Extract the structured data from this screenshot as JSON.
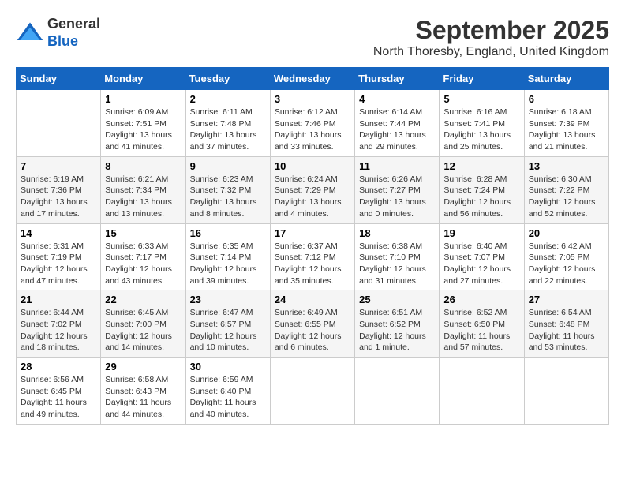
{
  "header": {
    "logo_line1": "General",
    "logo_line2": "Blue",
    "month": "September 2025",
    "location": "North Thoresby, England, United Kingdom"
  },
  "weekdays": [
    "Sunday",
    "Monday",
    "Tuesday",
    "Wednesday",
    "Thursday",
    "Friday",
    "Saturday"
  ],
  "weeks": [
    [
      {
        "day": "",
        "info": ""
      },
      {
        "day": "1",
        "info": "Sunrise: 6:09 AM\nSunset: 7:51 PM\nDaylight: 13 hours\nand 41 minutes."
      },
      {
        "day": "2",
        "info": "Sunrise: 6:11 AM\nSunset: 7:48 PM\nDaylight: 13 hours\nand 37 minutes."
      },
      {
        "day": "3",
        "info": "Sunrise: 6:12 AM\nSunset: 7:46 PM\nDaylight: 13 hours\nand 33 minutes."
      },
      {
        "day": "4",
        "info": "Sunrise: 6:14 AM\nSunset: 7:44 PM\nDaylight: 13 hours\nand 29 minutes."
      },
      {
        "day": "5",
        "info": "Sunrise: 6:16 AM\nSunset: 7:41 PM\nDaylight: 13 hours\nand 25 minutes."
      },
      {
        "day": "6",
        "info": "Sunrise: 6:18 AM\nSunset: 7:39 PM\nDaylight: 13 hours\nand 21 minutes."
      }
    ],
    [
      {
        "day": "7",
        "info": "Sunrise: 6:19 AM\nSunset: 7:36 PM\nDaylight: 13 hours\nand 17 minutes."
      },
      {
        "day": "8",
        "info": "Sunrise: 6:21 AM\nSunset: 7:34 PM\nDaylight: 13 hours\nand 13 minutes."
      },
      {
        "day": "9",
        "info": "Sunrise: 6:23 AM\nSunset: 7:32 PM\nDaylight: 13 hours\nand 8 minutes."
      },
      {
        "day": "10",
        "info": "Sunrise: 6:24 AM\nSunset: 7:29 PM\nDaylight: 13 hours\nand 4 minutes."
      },
      {
        "day": "11",
        "info": "Sunrise: 6:26 AM\nSunset: 7:27 PM\nDaylight: 13 hours\nand 0 minutes."
      },
      {
        "day": "12",
        "info": "Sunrise: 6:28 AM\nSunset: 7:24 PM\nDaylight: 12 hours\nand 56 minutes."
      },
      {
        "day": "13",
        "info": "Sunrise: 6:30 AM\nSunset: 7:22 PM\nDaylight: 12 hours\nand 52 minutes."
      }
    ],
    [
      {
        "day": "14",
        "info": "Sunrise: 6:31 AM\nSunset: 7:19 PM\nDaylight: 12 hours\nand 47 minutes."
      },
      {
        "day": "15",
        "info": "Sunrise: 6:33 AM\nSunset: 7:17 PM\nDaylight: 12 hours\nand 43 minutes."
      },
      {
        "day": "16",
        "info": "Sunrise: 6:35 AM\nSunset: 7:14 PM\nDaylight: 12 hours\nand 39 minutes."
      },
      {
        "day": "17",
        "info": "Sunrise: 6:37 AM\nSunset: 7:12 PM\nDaylight: 12 hours\nand 35 minutes."
      },
      {
        "day": "18",
        "info": "Sunrise: 6:38 AM\nSunset: 7:10 PM\nDaylight: 12 hours\nand 31 minutes."
      },
      {
        "day": "19",
        "info": "Sunrise: 6:40 AM\nSunset: 7:07 PM\nDaylight: 12 hours\nand 27 minutes."
      },
      {
        "day": "20",
        "info": "Sunrise: 6:42 AM\nSunset: 7:05 PM\nDaylight: 12 hours\nand 22 minutes."
      }
    ],
    [
      {
        "day": "21",
        "info": "Sunrise: 6:44 AM\nSunset: 7:02 PM\nDaylight: 12 hours\nand 18 minutes."
      },
      {
        "day": "22",
        "info": "Sunrise: 6:45 AM\nSunset: 7:00 PM\nDaylight: 12 hours\nand 14 minutes."
      },
      {
        "day": "23",
        "info": "Sunrise: 6:47 AM\nSunset: 6:57 PM\nDaylight: 12 hours\nand 10 minutes."
      },
      {
        "day": "24",
        "info": "Sunrise: 6:49 AM\nSunset: 6:55 PM\nDaylight: 12 hours\nand 6 minutes."
      },
      {
        "day": "25",
        "info": "Sunrise: 6:51 AM\nSunset: 6:52 PM\nDaylight: 12 hours\nand 1 minute."
      },
      {
        "day": "26",
        "info": "Sunrise: 6:52 AM\nSunset: 6:50 PM\nDaylight: 11 hours\nand 57 minutes."
      },
      {
        "day": "27",
        "info": "Sunrise: 6:54 AM\nSunset: 6:48 PM\nDaylight: 11 hours\nand 53 minutes."
      }
    ],
    [
      {
        "day": "28",
        "info": "Sunrise: 6:56 AM\nSunset: 6:45 PM\nDaylight: 11 hours\nand 49 minutes."
      },
      {
        "day": "29",
        "info": "Sunrise: 6:58 AM\nSunset: 6:43 PM\nDaylight: 11 hours\nand 44 minutes."
      },
      {
        "day": "30",
        "info": "Sunrise: 6:59 AM\nSunset: 6:40 PM\nDaylight: 11 hours\nand 40 minutes."
      },
      {
        "day": "",
        "info": ""
      },
      {
        "day": "",
        "info": ""
      },
      {
        "day": "",
        "info": ""
      },
      {
        "day": "",
        "info": ""
      }
    ]
  ]
}
